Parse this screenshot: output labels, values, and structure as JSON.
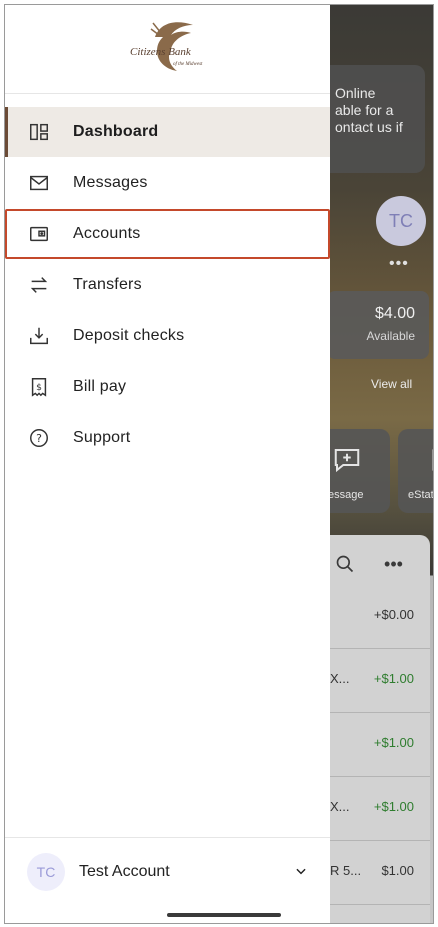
{
  "background": {
    "banner_lines": [
      "Online",
      "able for a",
      "ontact us if"
    ],
    "avatar_initials": "TC",
    "more_dots": "•••",
    "balance_amount": "$4.00",
    "balance_label": "Available",
    "view_all": "View all",
    "tiles": [
      {
        "label": "essage",
        "icon": "chat-plus-icon"
      },
      {
        "label": "eState",
        "icon": "document-icon"
      }
    ],
    "rows": [
      {
        "text": "",
        "amount": "+$0.00"
      },
      {
        "text": "X...",
        "amount": "+$1.00"
      },
      {
        "text": "",
        "amount": "+$1.00"
      },
      {
        "text": "X...",
        "amount": "+$1.00"
      },
      {
        "text": "R 5...",
        "amount": "$1.00"
      }
    ]
  },
  "drawer": {
    "logo_text": "Citizens Bank",
    "logo_subtext": "of the Midwest",
    "items": [
      {
        "label": "Dashboard",
        "icon": "dashboard-icon",
        "active": true
      },
      {
        "label": "Messages",
        "icon": "envelope-icon"
      },
      {
        "label": "Accounts",
        "icon": "wallet-icon",
        "highlighted": true
      },
      {
        "label": "Transfers",
        "icon": "transfer-arrows-icon"
      },
      {
        "label": "Deposit checks",
        "icon": "download-tray-icon"
      },
      {
        "label": "Bill pay",
        "icon": "dollar-receipt-icon"
      },
      {
        "label": "Support",
        "icon": "question-circle-icon"
      }
    ],
    "account": {
      "initials": "TC",
      "name": "Test Account"
    }
  },
  "colors": {
    "accent_brown": "#6b4b36",
    "active_bg": "#eeeae5",
    "highlight_outline": "#c4492b",
    "positive": "#2f7d2f"
  }
}
